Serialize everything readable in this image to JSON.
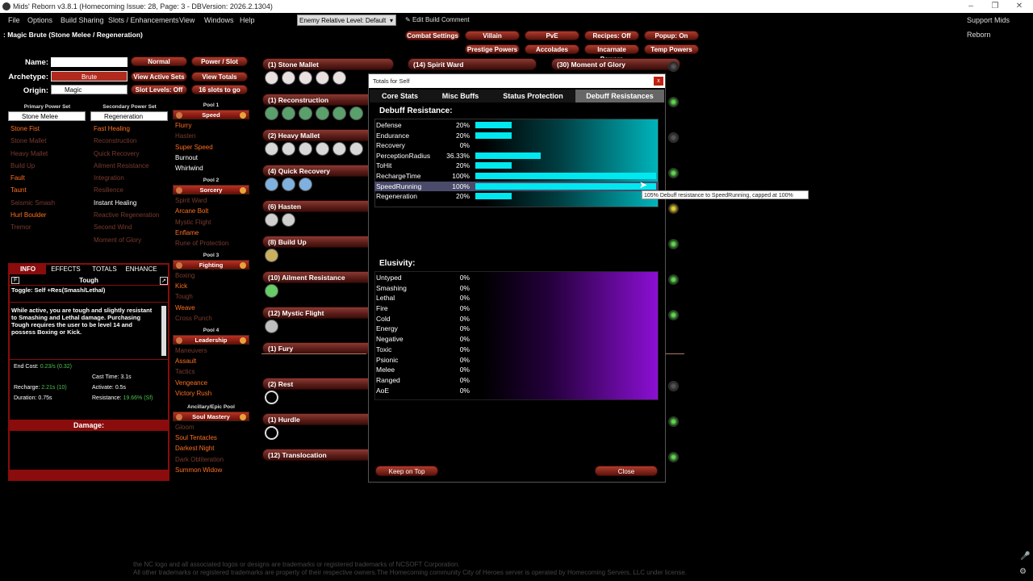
{
  "window": {
    "title": "Mids' Reborn v3.8.1  (Homecoming Issue: 28, Page: 3 - DBVersion: 2026.2.1304)",
    "support": "Support Mids Reborn"
  },
  "menu": [
    "File",
    "Options",
    "Build Sharing",
    "Slots / Enhancements",
    "View",
    "Windows",
    "Help"
  ],
  "toolbar": {
    "enemy_level": "Enemy Relative Level: Default",
    "edit_comment": "Edit Build Comment"
  },
  "top_buttons": [
    "Combat Settings",
    "Villain",
    "PvE",
    "Recipes: Off",
    "Popup: On",
    "Prestige Powers",
    "Accolades",
    "Incarnate Powers",
    "Temp Powers"
  ],
  "build_title": ": Magic Brute (Stone Melee / Regeneration)",
  "char": {
    "name_label": "Name:",
    "archetype_label": "Archetype:",
    "origin_label": "Origin:",
    "archetype": "Brute",
    "origin": "Magic",
    "normal": "Normal",
    "power_slot": "Power / Slot",
    "view_active_sets": "View Active Sets",
    "view_totals": "View Totals",
    "slot_levels": "Slot Levels: Off",
    "slots_to_go": "16 slots to go"
  },
  "primary": {
    "header": "Primary Power Set",
    "set": "Stone Melee",
    "powers": [
      {
        "n": "Stone Fist",
        "c": "orange"
      },
      {
        "n": "Stone Mallet",
        "c": "brown"
      },
      {
        "n": "Heavy Mallet",
        "c": "brown"
      },
      {
        "n": "Build Up",
        "c": "brown"
      },
      {
        "n": "Fault",
        "c": "orange"
      },
      {
        "n": "Taunt",
        "c": "orange"
      },
      {
        "n": "Seismic Smash",
        "c": "brown"
      },
      {
        "n": "Hurl Boulder",
        "c": "orange"
      },
      {
        "n": "Tremor",
        "c": "brown"
      }
    ]
  },
  "secondary": {
    "header": "Secondary Power Set",
    "set": "Regeneration",
    "powers": [
      {
        "n": "Fast Healing",
        "c": "orange"
      },
      {
        "n": "Reconstruction",
        "c": "brown"
      },
      {
        "n": "Quick Recovery",
        "c": "brown"
      },
      {
        "n": "Ailment Resistance",
        "c": "brown"
      },
      {
        "n": "Integration",
        "c": "brown"
      },
      {
        "n": "Resilience",
        "c": "brown"
      },
      {
        "n": "Instant Healing",
        "c": "white"
      },
      {
        "n": "Reactive Regeneration",
        "c": "brown"
      },
      {
        "n": "Second Wind",
        "c": "brown"
      },
      {
        "n": "Moment of Glory",
        "c": "brown"
      }
    ]
  },
  "pools": [
    {
      "header": "Pool 1",
      "name": "Speed",
      "powers": [
        {
          "n": "Flurry",
          "c": "orange"
        },
        {
          "n": "Hasten",
          "c": "brown"
        },
        {
          "n": "Super Speed",
          "c": "orange"
        },
        {
          "n": "Burnout",
          "c": "white"
        },
        {
          "n": "Whirlwind",
          "c": "white"
        }
      ]
    },
    {
      "header": "Pool 2",
      "name": "Sorcery",
      "powers": [
        {
          "n": "Spirit Ward",
          "c": "brown"
        },
        {
          "n": "Arcane Bolt",
          "c": "orange"
        },
        {
          "n": "Mystic Flight",
          "c": "brown"
        },
        {
          "n": "Enflame",
          "c": "orange"
        },
        {
          "n": "Rune of Protection",
          "c": "brown"
        }
      ]
    },
    {
      "header": "Pool 3",
      "name": "Fighting",
      "powers": [
        {
          "n": "Boxing",
          "c": "brown"
        },
        {
          "n": "Kick",
          "c": "orange"
        },
        {
          "n": "Tough",
          "c": "brown"
        },
        {
          "n": "Weave",
          "c": "orange"
        },
        {
          "n": "Cross Punch",
          "c": "brown"
        }
      ]
    },
    {
      "header": "Pool 4",
      "name": "Leadership",
      "powers": [
        {
          "n": "Maneuvers",
          "c": "brown"
        },
        {
          "n": "Assault",
          "c": "orange"
        },
        {
          "n": "Tactics",
          "c": "brown"
        },
        {
          "n": "Vengeance",
          "c": "orange"
        },
        {
          "n": "Victory Rush",
          "c": "orange"
        }
      ]
    },
    {
      "header": "Ancillary/Epic Pool",
      "name": "Soul Mastery",
      "powers": [
        {
          "n": "Gloom",
          "c": "brown"
        },
        {
          "n": "Soul Tentacles",
          "c": "orange"
        },
        {
          "n": "Darkest Night",
          "c": "orange"
        },
        {
          "n": "Dark Obliteration",
          "c": "brown"
        },
        {
          "n": "Summon Widow",
          "c": "orange"
        }
      ]
    }
  ],
  "slots_col1": [
    "(1) Stone Mallet",
    "(1) Reconstruction",
    "(2) Heavy Mallet",
    "(4) Quick Recovery",
    "(6) Hasten",
    "(8) Build Up",
    "(10) Ailment Resistance",
    "(12) Mystic Flight",
    "(1) Fury",
    "(2) Rest",
    "(1) Hurdle",
    "(12) Translocation"
  ],
  "slots_col2": [
    "(14) Spirit Ward",
    "(30) Moment of Glory"
  ],
  "info": {
    "tabs": [
      "INFO",
      "EFFECTS",
      "TOTALS",
      "ENHANCE"
    ],
    "power_name": "Tough",
    "f": "F",
    "subtitle": "Toggle: Self +Res(Smash/Lethal)",
    "desc": "While active, you are tough and slightly resistant to Smashing and Lethal damage. Purchasing Tough requires the user to be level 14 and possess Boxing or Kick.",
    "end_cost_label": "End Cost:",
    "end_cost": "0.23/s (0.32)",
    "cast_label": "Cast Time:",
    "cast": "3.1s",
    "recharge_label": "Recharge:",
    "recharge": "2.21s (10)",
    "activate_label": "Activate:",
    "activate": "0.5s",
    "duration_label": "Duration:",
    "duration": "0.75s",
    "resistance_label": "Resistance:",
    "resistance": "19.66% (Sf)",
    "damage_label": "Damage:"
  },
  "dialog": {
    "title": "Totals for Self",
    "tabs": [
      "Core Stats",
      "Misc Buffs",
      "Status Protection",
      "Debuff Resistances"
    ],
    "section1": "Debuff Resistance:",
    "section2": "Elusivity:",
    "keep_on_top": "Keep on Top",
    "close": "Close",
    "x": "x",
    "debuff": [
      {
        "l": "Defense",
        "v": "20%",
        "p": 0.2
      },
      {
        "l": "Endurance",
        "v": "20%",
        "p": 0.2
      },
      {
        "l": "Recovery",
        "v": "0%",
        "p": 0
      },
      {
        "l": "PerceptionRadius",
        "v": "36.33%",
        "p": 0.3633
      },
      {
        "l": "ToHit",
        "v": "20%",
        "p": 0.2
      },
      {
        "l": "RechargeTime",
        "v": "100%",
        "p": 1.0
      },
      {
        "l": "SpeedRunning",
        "v": "100%",
        "p": 1.0
      },
      {
        "l": "Regeneration",
        "v": "20%",
        "p": 0.2
      }
    ],
    "elusivity": [
      {
        "l": "Untyped",
        "v": "0%"
      },
      {
        "l": "Smashing",
        "v": "0%"
      },
      {
        "l": "Lethal",
        "v": "0%"
      },
      {
        "l": "Fire",
        "v": "0%"
      },
      {
        "l": "Cold",
        "v": "0%"
      },
      {
        "l": "Energy",
        "v": "0%"
      },
      {
        "l": "Negative",
        "v": "0%"
      },
      {
        "l": "Toxic",
        "v": "0%"
      },
      {
        "l": "Psionic",
        "v": "0%"
      },
      {
        "l": "Melee",
        "v": "0%"
      },
      {
        "l": "Ranged",
        "v": "0%"
      },
      {
        "l": "AoE",
        "v": "0%"
      }
    ],
    "tooltip": "105% Debuff resistance to SpeedRunning, capped at 100%"
  },
  "footer": [
    "the NC logo and all associated logos or designs are trademarks or registered trademarks of NCSOFT Corporation.",
    "All other trademarks or registered trademarks are property of their respective owners.The Homecoming community City of Heroes server is operated by Homecoming Servers, LLC under license."
  ]
}
